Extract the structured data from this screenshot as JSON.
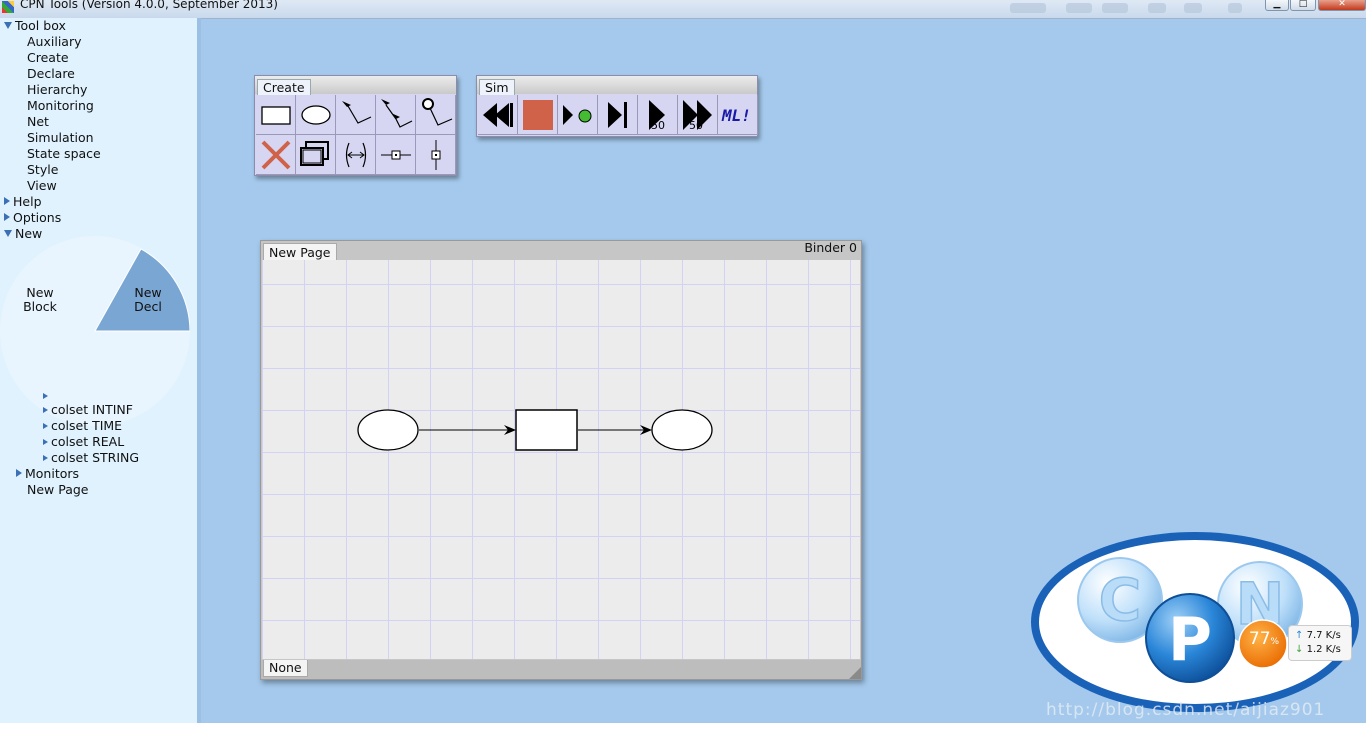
{
  "window": {
    "title": "CPN Tools (Version 4.0.0, September 2013)",
    "controls": [
      "minimize",
      "maximize",
      "close"
    ]
  },
  "sidebar": {
    "toolbox": {
      "label": "Tool box",
      "items": [
        "Auxiliary",
        "Create",
        "Declare",
        "Hierarchy",
        "Monitoring",
        "Net",
        "Simulation",
        "State space",
        "Style",
        "View"
      ]
    },
    "help": "Help",
    "options": "Options",
    "new_net": "New",
    "pie_menu": {
      "left": "New\nBlock",
      "right": "New\nDecl"
    },
    "colsets": [
      "colset INTINF",
      "colset TIME",
      "colset REAL",
      "colset STRING"
    ],
    "monitors": "Monitors",
    "new_page": "New Page"
  },
  "create_palette": {
    "tab": "Create",
    "tools": [
      {
        "icon": "transition-rect-icon"
      },
      {
        "icon": "place-ellipse-icon"
      },
      {
        "icon": "arc-icon"
      },
      {
        "icon": "double-arc-icon"
      },
      {
        "icon": "reset-arc-icon"
      },
      {
        "icon": "delete-icon"
      },
      {
        "icon": "clone-icon"
      },
      {
        "icon": "toggle-arc-direction-icon"
      },
      {
        "icon": "horizontal-guideline-icon"
      },
      {
        "icon": "vertical-guideline-icon"
      }
    ]
  },
  "sim_palette": {
    "tab": "Sim",
    "tools": [
      {
        "icon": "rewind-icon"
      },
      {
        "icon": "stop-icon"
      },
      {
        "icon": "play-single-icon"
      },
      {
        "icon": "step-to-end-icon"
      },
      {
        "icon": "play-steps-icon",
        "label": "50"
      },
      {
        "icon": "fast-forward-icon",
        "label": "50"
      },
      {
        "icon": "ml-evaluate-icon",
        "label": "ML!"
      }
    ],
    "stop_color": "#d0624a"
  },
  "binder": {
    "page_tab": "New Page",
    "label": "Binder 0",
    "footer_tab": "None"
  },
  "net_monitor": {
    "percent": "77",
    "percent_suffix": "%",
    "up": "7.7 K/s",
    "down": "1.2 K/s"
  },
  "logo": {
    "letters": [
      "C",
      "P",
      "N"
    ]
  },
  "watermark": "http://blog.csdn.net/aijiaz901"
}
